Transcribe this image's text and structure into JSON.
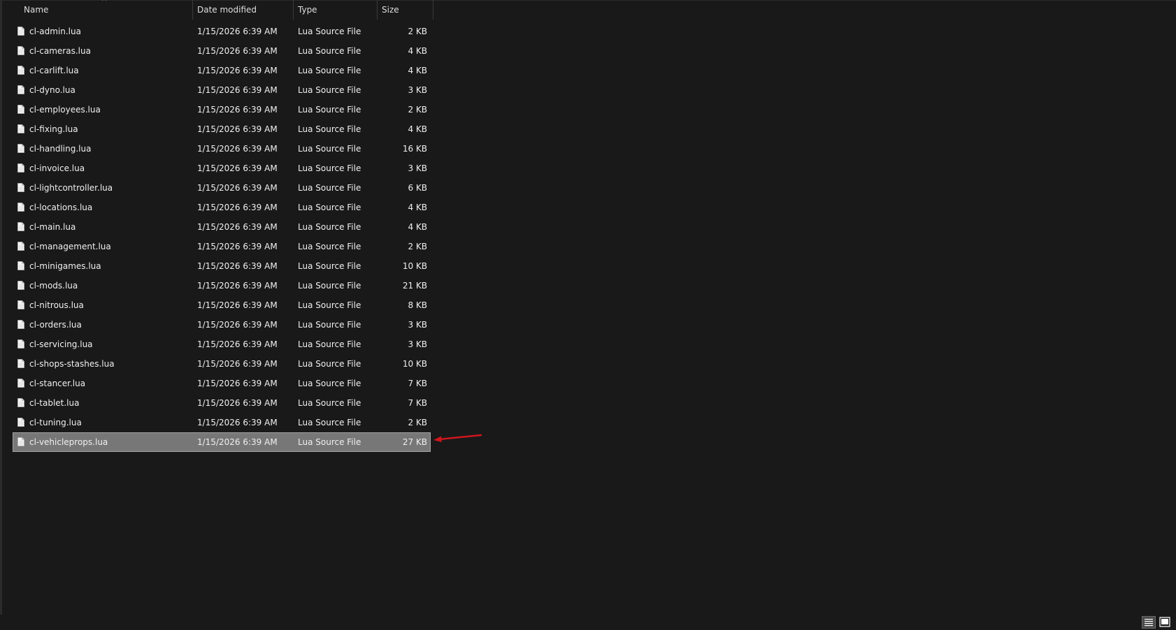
{
  "columns": {
    "name": "Name",
    "date": "Date modified",
    "type": "Type",
    "size": "Size"
  },
  "sort_indicator": "^",
  "files": [
    {
      "name": "cl-admin.lua",
      "date": "1/15/2026 6:39 AM",
      "type": "Lua Source File",
      "size": "2 KB"
    },
    {
      "name": "cl-cameras.lua",
      "date": "1/15/2026 6:39 AM",
      "type": "Lua Source File",
      "size": "4 KB"
    },
    {
      "name": "cl-carlift.lua",
      "date": "1/15/2026 6:39 AM",
      "type": "Lua Source File",
      "size": "4 KB"
    },
    {
      "name": "cl-dyno.lua",
      "date": "1/15/2026 6:39 AM",
      "type": "Lua Source File",
      "size": "3 KB"
    },
    {
      "name": "cl-employees.lua",
      "date": "1/15/2026 6:39 AM",
      "type": "Lua Source File",
      "size": "2 KB"
    },
    {
      "name": "cl-fixing.lua",
      "date": "1/15/2026 6:39 AM",
      "type": "Lua Source File",
      "size": "4 KB"
    },
    {
      "name": "cl-handling.lua",
      "date": "1/15/2026 6:39 AM",
      "type": "Lua Source File",
      "size": "16 KB"
    },
    {
      "name": "cl-invoice.lua",
      "date": "1/15/2026 6:39 AM",
      "type": "Lua Source File",
      "size": "3 KB"
    },
    {
      "name": "cl-lightcontroller.lua",
      "date": "1/15/2026 6:39 AM",
      "type": "Lua Source File",
      "size": "6 KB"
    },
    {
      "name": "cl-locations.lua",
      "date": "1/15/2026 6:39 AM",
      "type": "Lua Source File",
      "size": "4 KB"
    },
    {
      "name": "cl-main.lua",
      "date": "1/15/2026 6:39 AM",
      "type": "Lua Source File",
      "size": "4 KB"
    },
    {
      "name": "cl-management.lua",
      "date": "1/15/2026 6:39 AM",
      "type": "Lua Source File",
      "size": "2 KB"
    },
    {
      "name": "cl-minigames.lua",
      "date": "1/15/2026 6:39 AM",
      "type": "Lua Source File",
      "size": "10 KB"
    },
    {
      "name": "cl-mods.lua",
      "date": "1/15/2026 6:39 AM",
      "type": "Lua Source File",
      "size": "21 KB"
    },
    {
      "name": "cl-nitrous.lua",
      "date": "1/15/2026 6:39 AM",
      "type": "Lua Source File",
      "size": "8 KB"
    },
    {
      "name": "cl-orders.lua",
      "date": "1/15/2026 6:39 AM",
      "type": "Lua Source File",
      "size": "3 KB"
    },
    {
      "name": "cl-servicing.lua",
      "date": "1/15/2026 6:39 AM",
      "type": "Lua Source File",
      "size": "3 KB"
    },
    {
      "name": "cl-shops-stashes.lua",
      "date": "1/15/2026 6:39 AM",
      "type": "Lua Source File",
      "size": "10 KB"
    },
    {
      "name": "cl-stancer.lua",
      "date": "1/15/2026 6:39 AM",
      "type": "Lua Source File",
      "size": "7 KB"
    },
    {
      "name": "cl-tablet.lua",
      "date": "1/15/2026 6:39 AM",
      "type": "Lua Source File",
      "size": "7 KB"
    },
    {
      "name": "cl-tuning.lua",
      "date": "1/15/2026 6:39 AM",
      "type": "Lua Source File",
      "size": "2 KB"
    },
    {
      "name": "cl-vehicleprops.lua",
      "date": "1/15/2026 6:39 AM",
      "type": "Lua Source File",
      "size": "27 KB",
      "selected": true
    }
  ],
  "icons": {
    "file": "file-icon",
    "arrow": "red-arrow-annotation",
    "details_view": "details-view-icon",
    "tiles_view": "tiles-view-icon"
  },
  "colors": {
    "background": "#191919",
    "selected_row": "#777777",
    "annotation_arrow": "#d0151c",
    "text": "#f0f0f0"
  }
}
